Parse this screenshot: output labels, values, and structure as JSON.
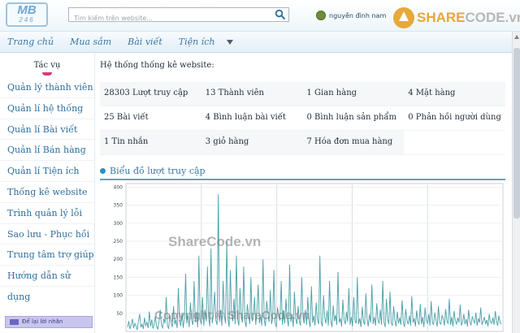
{
  "header": {
    "logo_top": "MB",
    "logo_bottom": "246",
    "search_placeholder": "Tìm kiếm trên website...",
    "user_name": "nguyễn đình nam",
    "watermark_logo_pre": "SHARE",
    "watermark_logo_post": "CODE.vn"
  },
  "nav": {
    "items": [
      {
        "label": "Trang chủ"
      },
      {
        "label": "Mua sắm"
      },
      {
        "label": "Bài viết"
      },
      {
        "label": "Tiện ích"
      }
    ]
  },
  "sidebar": {
    "heading": "Tác vụ",
    "items": [
      {
        "label": "Quản lý thành viên"
      },
      {
        "label": "Quản lí hệ thống"
      },
      {
        "label": "Quản lí Bài viết"
      },
      {
        "label": "Quản lí Bán hàng"
      },
      {
        "label": "Quản lí Tiện ích"
      },
      {
        "label": "Thống kê website"
      },
      {
        "label": "Trình quản lý lỗi"
      },
      {
        "label": "Sao lưu - Phục hồi"
      },
      {
        "label": "Trung tâm trợ giúp"
      },
      {
        "label": "Hướng dẫn sử dụng"
      }
    ],
    "message_button": "Để lại lời nhắn"
  },
  "main": {
    "section_title": "Hệ thống thống kê website:",
    "stats": [
      [
        "28303 Lượt truy cập",
        "13 Thành viên",
        "1 Gian hàng",
        "4 Mặt hàng"
      ],
      [
        "25 Bài viết",
        "4 Bình luận bài viết",
        "0 Bình luận sản phẩm",
        "0 Phản hồi người dùng"
      ],
      [
        "1 Tin nhắn",
        "3 giỏ hàng",
        "7 Hóa đơn mua hàng",
        ""
      ]
    ],
    "chart_title": "Biểu đồ lượt truy cập"
  },
  "watermarks": {
    "center": "ShareCode.vn",
    "bottom": "Copyright © ShareCode.vn"
  },
  "colors": {
    "accent": "#3a78a6",
    "series": "#4a9fa8"
  },
  "chart_data": {
    "type": "line",
    "title": "Biểu đồ lượt truy cập",
    "xlabel": "",
    "ylabel": "",
    "ylim": [
      0,
      410
    ],
    "yticks": [
      50,
      100,
      150,
      200,
      250,
      300,
      350,
      400
    ],
    "grid": true,
    "series": [
      {
        "values": [
          12,
          28,
          6,
          18,
          35,
          9,
          22,
          15,
          4,
          30,
          48,
          11,
          20,
          7,
          38,
          16,
          25,
          9,
          55,
          14,
          33,
          8,
          21,
          42,
          13,
          6,
          27,
          60,
          18,
          10,
          36,
          22,
          95,
          14,
          8,
          45,
          24,
          12,
          70,
          19,
          33,
          9,
          120,
          28,
          15,
          52,
          10,
          38,
          160,
          22,
          46,
          12,
          80,
          30,
          18,
          140,
          25,
          55,
          11,
          210,
          34,
          20,
          95,
          16,
          60,
          28,
          180,
          40,
          14,
          230,
          22,
          48,
          110,
          30,
          18,
          380,
          26,
          60,
          15,
          140,
          44,
          22,
          250,
          36,
          12,
          170,
          50,
          28,
          90,
          20,
          210,
          34,
          16,
          120,
          40,
          24,
          180,
          30,
          12,
          75,
          46,
          20,
          150,
          28,
          36,
          95,
          18,
          60,
          130,
          22,
          44,
          16,
          200,
          32,
          14,
          85,
          50,
          26,
          115,
          20,
          38,
          170,
          24,
          12,
          66,
          42,
          30,
          140,
          18,
          56,
          22,
          90,
          34,
          14,
          185,
          26,
          48,
          12,
          110,
          36,
          20,
          70,
          28,
          16,
          150,
          40,
          22,
          60,
          18,
          95,
          30,
          12,
          125,
          24,
          44,
          16,
          80,
          34,
          20,
          210,
          26,
          14,
          100,
          38,
          22,
          58,
          16,
          140,
          30,
          12,
          72,
          28,
          46,
          18,
          165,
          24,
          36,
          14,
          88,
          32,
          20,
          55,
          26,
          120,
          18,
          40,
          14,
          95,
          30,
          22,
          150,
          20,
          36,
          12,
          68,
          28,
          18,
          105,
          34,
          14,
          48,
          24,
          130,
          20,
          40,
          16,
          78,
          30,
          22,
          60,
          18,
          140,
          26,
          12,
          90,
          34,
          20,
          110,
          24,
          16,
          70,
          30,
          14,
          55,
          22,
          38,
          18,
          86,
          26,
          12,
          62,
          30,
          20,
          44,
          16,
          98,
          24,
          36,
          14,
          58,
          28,
          18,
          76,
          20,
          40,
          12,
          66,
          30,
          22,
          48,
          16,
          84,
          26,
          18,
          52,
          32,
          14,
          70,
          24,
          20,
          44,
          36,
          16,
          62,
          28,
          22,
          90,
          18,
          40,
          14,
          56,
          30,
          20,
          38,
          24,
          74,
          16,
          28,
          48,
          20,
          34,
          14,
          60,
          26,
          18,
          42,
          30,
          22,
          52,
          16,
          36,
          24,
          66,
          18,
          28,
          40,
          20,
          32,
          14,
          48,
          26,
          22,
          38,
          18,
          56,
          30,
          16,
          44,
          24,
          20
        ]
      }
    ]
  }
}
